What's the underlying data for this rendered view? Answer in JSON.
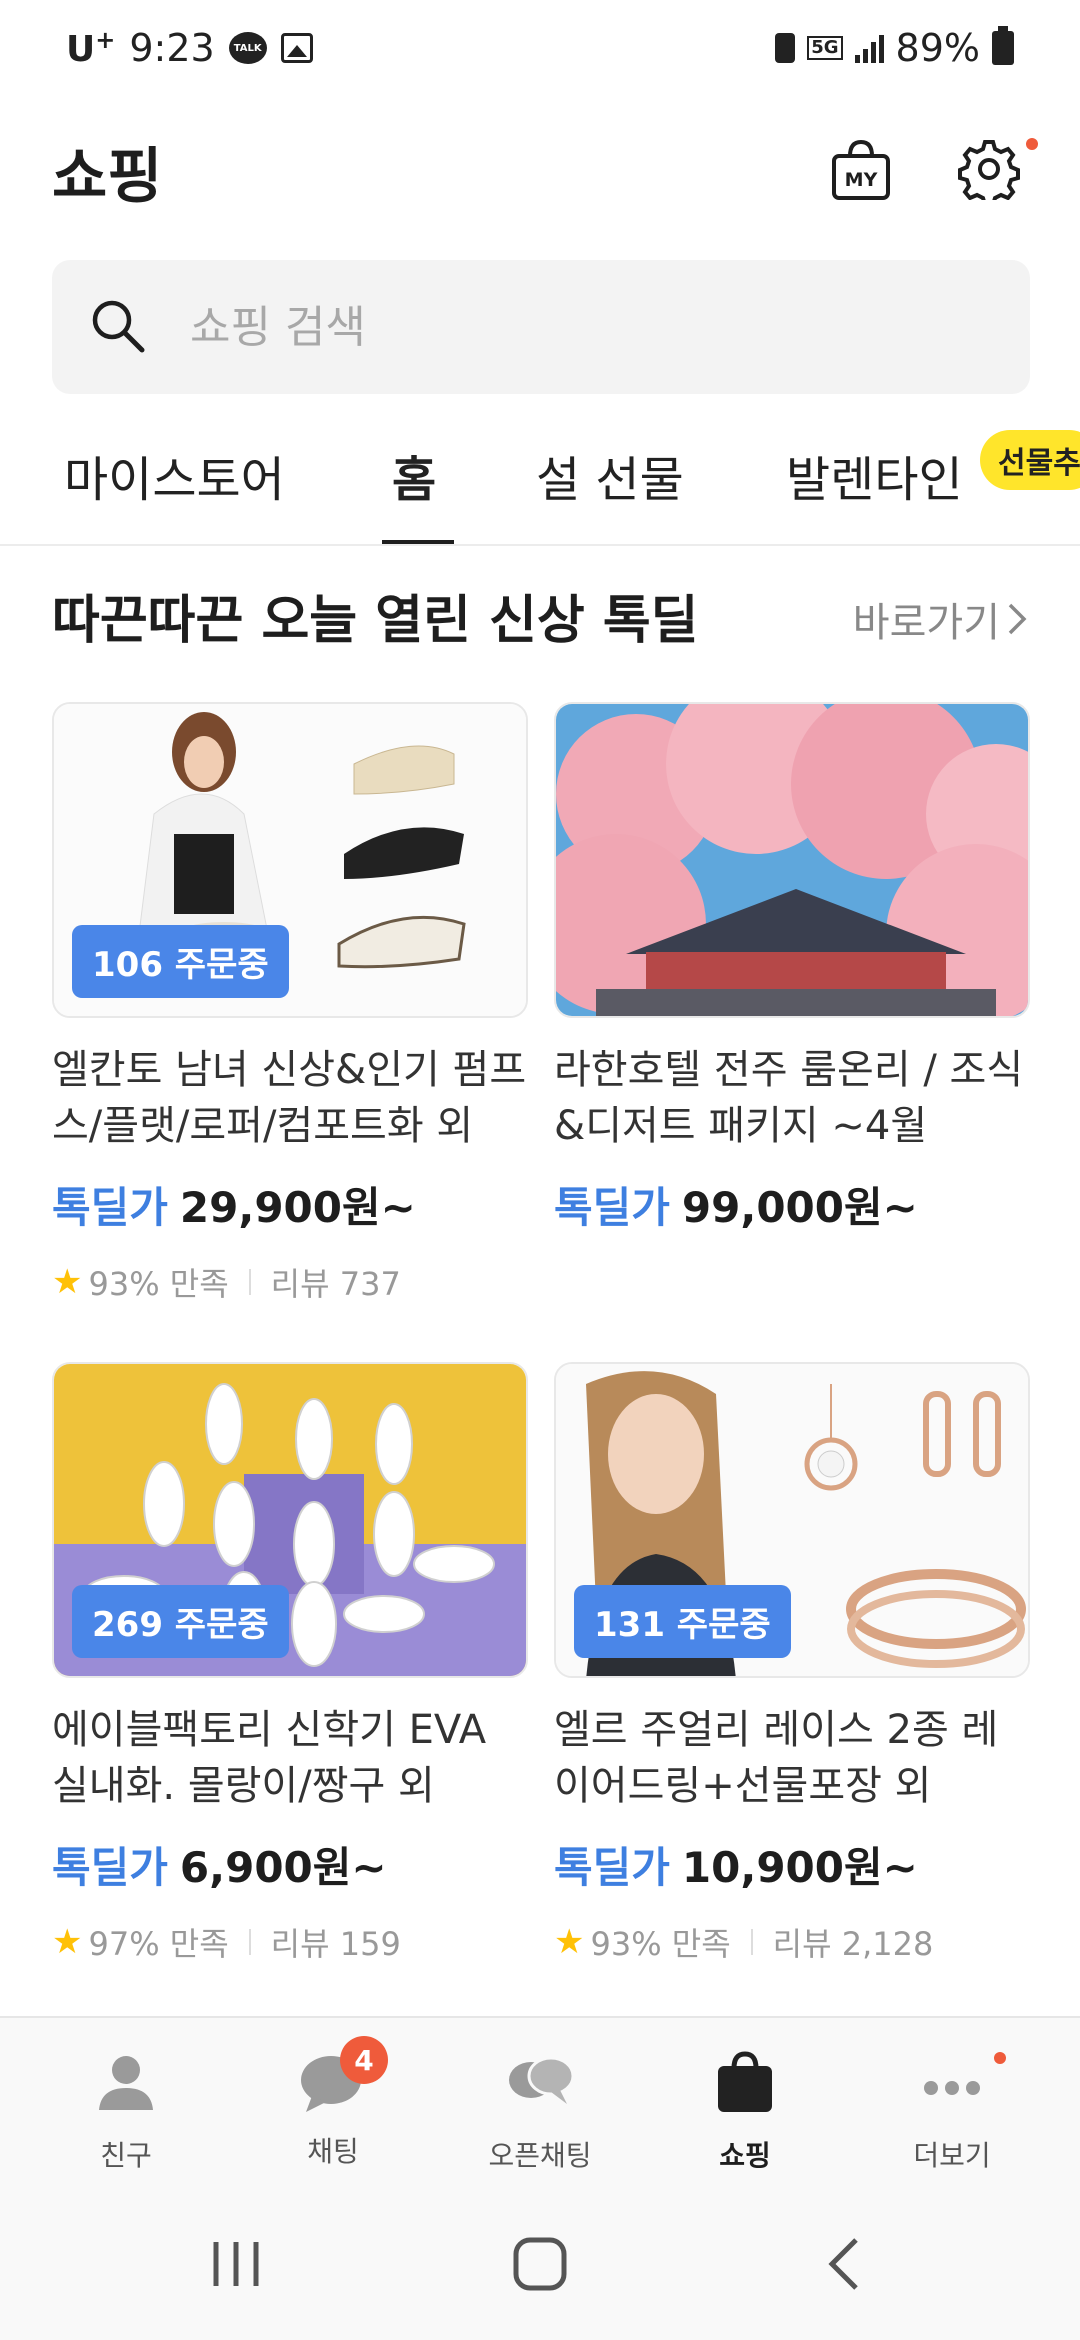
{
  "status_bar": {
    "carrier": "U",
    "carrier_sup": "+",
    "time": "9:23",
    "talk_label": "TALK",
    "network": "5G",
    "battery": "89%"
  },
  "header": {
    "title": "쇼핑",
    "my_label": "MY"
  },
  "search": {
    "placeholder": "쇼핑 검색"
  },
  "tabs": [
    {
      "label": "마이스토어",
      "active": false
    },
    {
      "label": "홈",
      "active": true
    },
    {
      "label": "설 선물",
      "active": false
    },
    {
      "label": "발렌타인",
      "active": false
    }
  ],
  "tab_badge": "선물추",
  "section": {
    "title": "따끈따끈 오늘 열린 신상 톡딜",
    "link": "바로가기"
  },
  "products": [
    {
      "name": "엘칸토 남녀 신상&인기 펌프스/플랫/로퍼/컴포트화 외",
      "deal_label": "톡딜가",
      "price": "29,900원~",
      "orders": "106 주문중",
      "rating": "93% 만족",
      "reviews": "리뷰 737"
    },
    {
      "name": "라한호텔 전주 룸온리 / 조식&디저트 패키지 ~4월",
      "deal_label": "톡딜가",
      "price": "99,000원~",
      "orders": "",
      "rating": "",
      "reviews": ""
    },
    {
      "name": "에이블팩토리 신학기 EVA 실내화. 몰랑이/짱구 외",
      "deal_label": "톡딜가",
      "price": "6,900원~",
      "orders": "269 주문중",
      "rating": "97% 만족",
      "reviews": "리뷰 159"
    },
    {
      "name": "엘르 주얼리 레이스 2종 레이어드링+선물포장 외",
      "deal_label": "톡딜가",
      "price": "10,900원~",
      "orders": "131 주문중",
      "rating": "93% 만족",
      "reviews": "리뷰 2,128"
    }
  ],
  "bottom_nav": [
    {
      "label": "친구",
      "icon": "person-icon"
    },
    {
      "label": "채팅",
      "icon": "chat-bubble-icon",
      "badge": "4"
    },
    {
      "label": "오픈채팅",
      "icon": "open-chat-icon"
    },
    {
      "label": "쇼핑",
      "icon": "shopping-bag-icon",
      "active": true
    },
    {
      "label": "더보기",
      "icon": "more-dots-icon"
    }
  ],
  "colors": {
    "accent_blue": "#3e7fe0",
    "badge_blue": "#4a86e8",
    "notify_red": "#ef5b3b",
    "tab_badge_yellow": "#ffe52b"
  }
}
